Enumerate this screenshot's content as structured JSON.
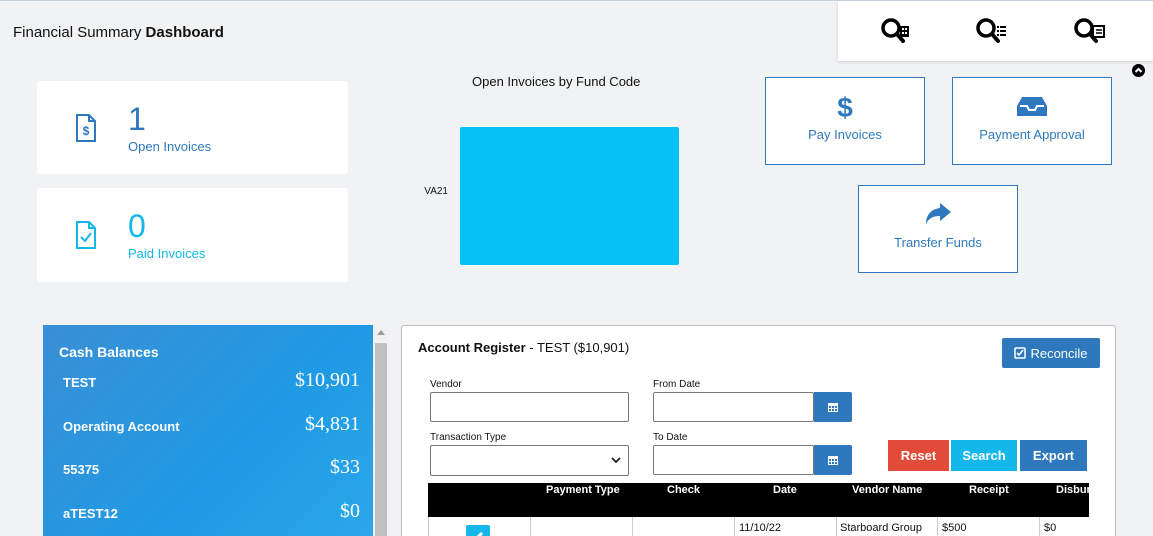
{
  "header": {
    "title_prefix": "Financial Summary",
    "title_bold": "Dashboard"
  },
  "search_panel": {
    "icons": [
      "search-building-icon",
      "search-list-icon",
      "search-document-icon"
    ]
  },
  "stats": {
    "open_invoices": {
      "value": "1",
      "label": "Open Invoices",
      "icon": "invoice-dollar-icon",
      "color": "#2e79bd"
    },
    "paid_invoices": {
      "value": "0",
      "label": "Paid Invoices",
      "icon": "invoice-check-icon",
      "color": "#13b7ea"
    }
  },
  "chart_title": "Open Invoices by Fund Code",
  "chart_data": {
    "type": "bar",
    "orientation": "horizontal",
    "title": "Open Invoices by Fund Code",
    "categories": [
      "VA21"
    ],
    "values": [
      1
    ],
    "color": "#08c1f4"
  },
  "actions": {
    "pay_invoices": {
      "label": "Pay Invoices",
      "icon": "dollar-icon"
    },
    "payment_approval": {
      "label": "Payment Approval",
      "icon": "inbox-icon"
    },
    "transfer_funds": {
      "label": "Transfer Funds",
      "icon": "share-arrow-icon"
    }
  },
  "cash_balances": {
    "title": "Cash Balances",
    "rows": [
      {
        "name": "TEST",
        "value": "$10,901"
      },
      {
        "name": "Operating Account",
        "value": "$4,831"
      },
      {
        "name": "55375",
        "value": "$33"
      },
      {
        "name": "aTEST12",
        "value": "$0"
      }
    ]
  },
  "register": {
    "title_bold": "Account Register",
    "title_rest": " - TEST ($10,901)",
    "reconcile_label": "Reconcile",
    "filters": {
      "vendor_label": "Vendor",
      "vendor_value": "",
      "from_date_label": "From Date",
      "from_date_value": "",
      "transaction_type_label": "Transaction Type",
      "transaction_type_value": "",
      "to_date_label": "To Date",
      "to_date_value": ""
    },
    "buttons": {
      "reset": "Reset",
      "search": "Search",
      "export": "Export"
    },
    "columns": [
      "Payment Type",
      "Check",
      "Date",
      "Vendor Name",
      "Receipt",
      "Disbur"
    ],
    "rows": [
      {
        "payment_type": "",
        "check": "",
        "date": "11/10/22",
        "vendor_name": "Starboard Group",
        "receipt": "$500",
        "disbursement": "$0"
      }
    ]
  }
}
